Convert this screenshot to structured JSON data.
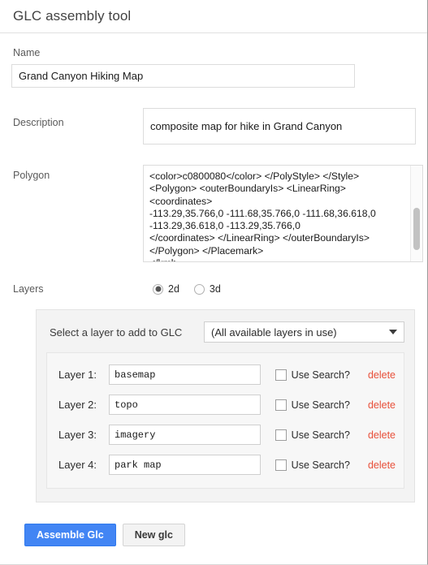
{
  "header": {
    "title": "GLC assembly tool"
  },
  "form": {
    "name": {
      "label": "Name",
      "value": "Grand Canyon Hiking Map",
      "placeholder": ""
    },
    "description": {
      "label": "Description",
      "value": "composite map for hike in Grand Canyon",
      "placeholder": ""
    },
    "polygon": {
      "label": "Polygon",
      "value": "<color>c0800080</color> </PolyStyle> </Style>\n<Polygon> <outerBoundaryIs> <LinearRing>\n<coordinates>\n-113.29,35.766,0 -111.68,35.766,0 -111.68,36.618,0\n-113.29,36.618,0 -113.29,35.766,0\n</coordinates> </LinearRing> </outerBoundaryIs>\n</Polygon> </Placemark>\n</kml>"
    },
    "layers": {
      "label": "Layers",
      "options": [
        {
          "value": "2d",
          "label": "2d",
          "selected": true
        },
        {
          "value": "3d",
          "label": "3d",
          "selected": false
        }
      ]
    }
  },
  "layers_panel": {
    "select_label": "Select a layer to add to GLC",
    "select_value": "(All available layers in use)",
    "select_arrow_icon": "chevron-down-icon",
    "rows": [
      {
        "label": "Layer 1:",
        "value": "basemap",
        "use_search_label": "Use Search?",
        "use_search_checked": false,
        "delete_label": "delete"
      },
      {
        "label": "Layer 2:",
        "value": "topo",
        "use_search_label": "Use Search?",
        "use_search_checked": false,
        "delete_label": "delete"
      },
      {
        "label": "Layer 3:",
        "value": "imagery",
        "use_search_label": "Use Search?",
        "use_search_checked": false,
        "delete_label": "delete"
      },
      {
        "label": "Layer 4:",
        "value": "park map",
        "use_search_label": "Use Search?",
        "use_search_checked": false,
        "delete_label": "delete"
      }
    ]
  },
  "footer": {
    "assemble_label": "Assemble Glc",
    "new_label": "New glc"
  },
  "colors": {
    "primary_button": "#4285f4",
    "delete_link": "#e8503a",
    "panel_background": "#f3f3f3",
    "border": "#dcdcdc"
  }
}
